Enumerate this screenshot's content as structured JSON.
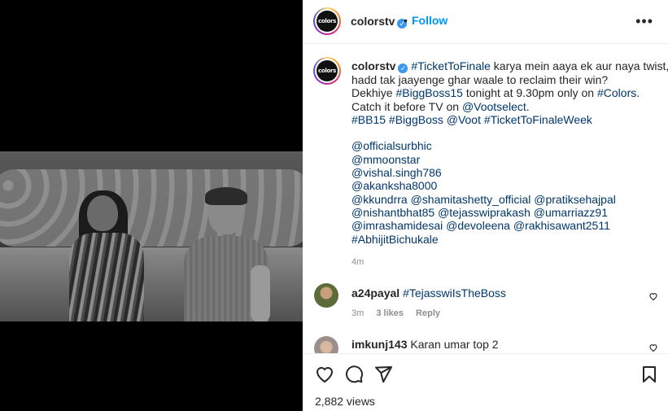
{
  "post": {
    "author": "colorstv",
    "logo_text": "colors",
    "follow_label": "Follow",
    "separator": "•"
  },
  "caption": {
    "author": "colorstv",
    "lines": [
      [
        "#TicketToFinale",
        " karya mein aaya ek aur naya twist, kis"
      ],
      [
        "hadd tak jaayenge ghar waale to reclaim their win?"
      ],
      [
        "Dekhiye ",
        "#BiggBoss15",
        " tonight at 9.30pm only on ",
        "#Colors",
        "."
      ],
      [
        "Catch it before TV on ",
        "@Vootselect",
        "."
      ],
      [
        "#BB15 #BiggBoss @Voot #TicketToFinaleWeek"
      ],
      [
        "@officialsurbhic"
      ],
      [
        "@mmoonstar"
      ],
      [
        "@vishal.singh786"
      ],
      [
        "@akanksha8000"
      ],
      [
        "@kkundrra @shamitashetty_official @pratiksehajpal"
      ],
      [
        "@nishantbhat85 @tejasswiprakash @umarriazz91"
      ],
      [
        "@imrashamidesai @devoleena @rakhisawant2511"
      ],
      [
        "#AbhijitBichukale"
      ]
    ],
    "time": "4m"
  },
  "comments": [
    {
      "user": "a24payal",
      "text": "#TejasswiIsTheBoss",
      "time": "3m",
      "likes": "3 likes",
      "reply": "Reply"
    },
    {
      "user": "imkunj143",
      "text": "Karan umar top 2"
    }
  ],
  "actions": {
    "icons": [
      "heart-icon",
      "comment-icon",
      "share-icon",
      "bookmark-icon"
    ],
    "views": "2,882 views"
  },
  "colors": {
    "link": "#00376b",
    "follow": "#0095f6",
    "meta": "#8e8e8e",
    "verified": "#3897f0"
  }
}
